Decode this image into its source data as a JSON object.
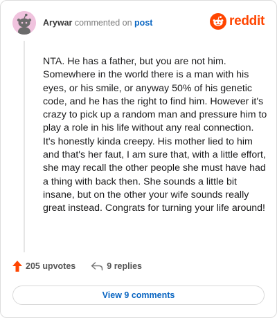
{
  "header": {
    "username": "Arywar",
    "action_text": "commented on",
    "post_link": "post",
    "brand": "reddit"
  },
  "comment": {
    "body": "NTA. He has a father, but you are not him. Somewhere in the world there is a man with his eyes, or his smile, or anyway 50% of his genetic code, and he has the right to find him. However it's crazy to pick up a random man and pressure him to play a role in his life without any real connection. It's honestly kinda creepy. His mother lied to him and that's her faut, I am sure that, with a little effort, she may recall the other people she must have had a thing with back then. She sounds a little bit insane, but on the other your wife sounds really great instead. Congrats for turning your life around!"
  },
  "footer": {
    "upvotes": "205 upvotes",
    "replies": "9 replies",
    "view_comments": "View 9 comments"
  },
  "icons": {
    "avatar": "snoo-avatar-icon",
    "brand": "reddit-logo-icon",
    "upvote": "upvote-arrow-icon",
    "reply": "reply-arrow-icon"
  },
  "colors": {
    "brand": "#ff4500",
    "link": "#0a66c2",
    "avatar_bg": "#f0c3de",
    "avatar_figure": "#6b6b6b"
  }
}
